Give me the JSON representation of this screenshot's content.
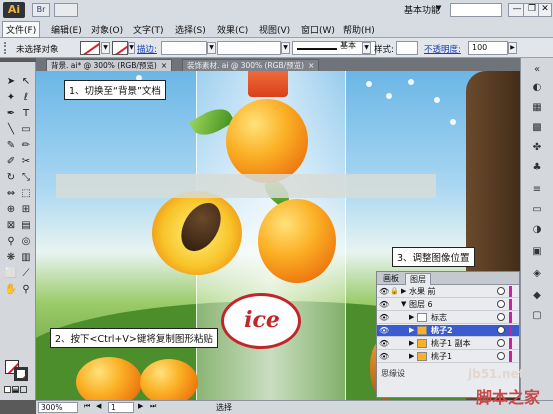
{
  "app": {
    "logo": "Ai",
    "workspace": "基本功能",
    "workspace_dropdown": "▼"
  },
  "menu": [
    "文件(F)",
    "编辑(E)",
    "对象(O)",
    "文字(T)",
    "选择(S)",
    "效果(C)",
    "视图(V)",
    "窗口(W)",
    "帮助(H)"
  ],
  "window_controls": [
    "—",
    "❐",
    "✕"
  ],
  "controlbar": {
    "no_selection": "未选择对象",
    "stroke_label": "描边:",
    "stroke_profile": "基本",
    "style_label": "样式:",
    "opacity_label": "不透明度:",
    "opacity_value": "100"
  },
  "tabs": [
    {
      "label": "背景. ai* @ 300% (RGB/预览)",
      "close": "×"
    },
    {
      "label": "装饰素材. ai @ 300% (RGB/预览)",
      "close": "×"
    }
  ],
  "callouts": {
    "step1": "1、切换至“背景”文档",
    "step2": "2、按下<Ctrl+V>键将复制图形粘贴",
    "step3": "3、调整图像位置"
  },
  "canvas": {
    "logo_text": "ice"
  },
  "layers_panel": {
    "tabs": [
      "画板",
      "图层"
    ],
    "rows": [
      {
        "name": "水果 前",
        "indent": 0,
        "selected": false
      },
      {
        "name": "图层 6",
        "indent": 0,
        "selected": false
      },
      {
        "name": "标志",
        "indent": 1,
        "selected": false
      },
      {
        "name": "桃子2",
        "indent": 1,
        "selected": true
      },
      {
        "name": "桃子1 副本",
        "indent": 1,
        "selected": false
      },
      {
        "name": "桃子1",
        "indent": 1,
        "selected": false
      }
    ],
    "footer": "思缘设"
  },
  "statusbar": {
    "zoom": "300%",
    "page": "1",
    "status": "选择"
  },
  "watermarks": {
    "site": "jb51.net",
    "site_cn": "脚本之家"
  },
  "colors": {
    "accent": "#3b5ccf",
    "layer_color": "#c6249f",
    "stroke_none": "#d8232a"
  }
}
